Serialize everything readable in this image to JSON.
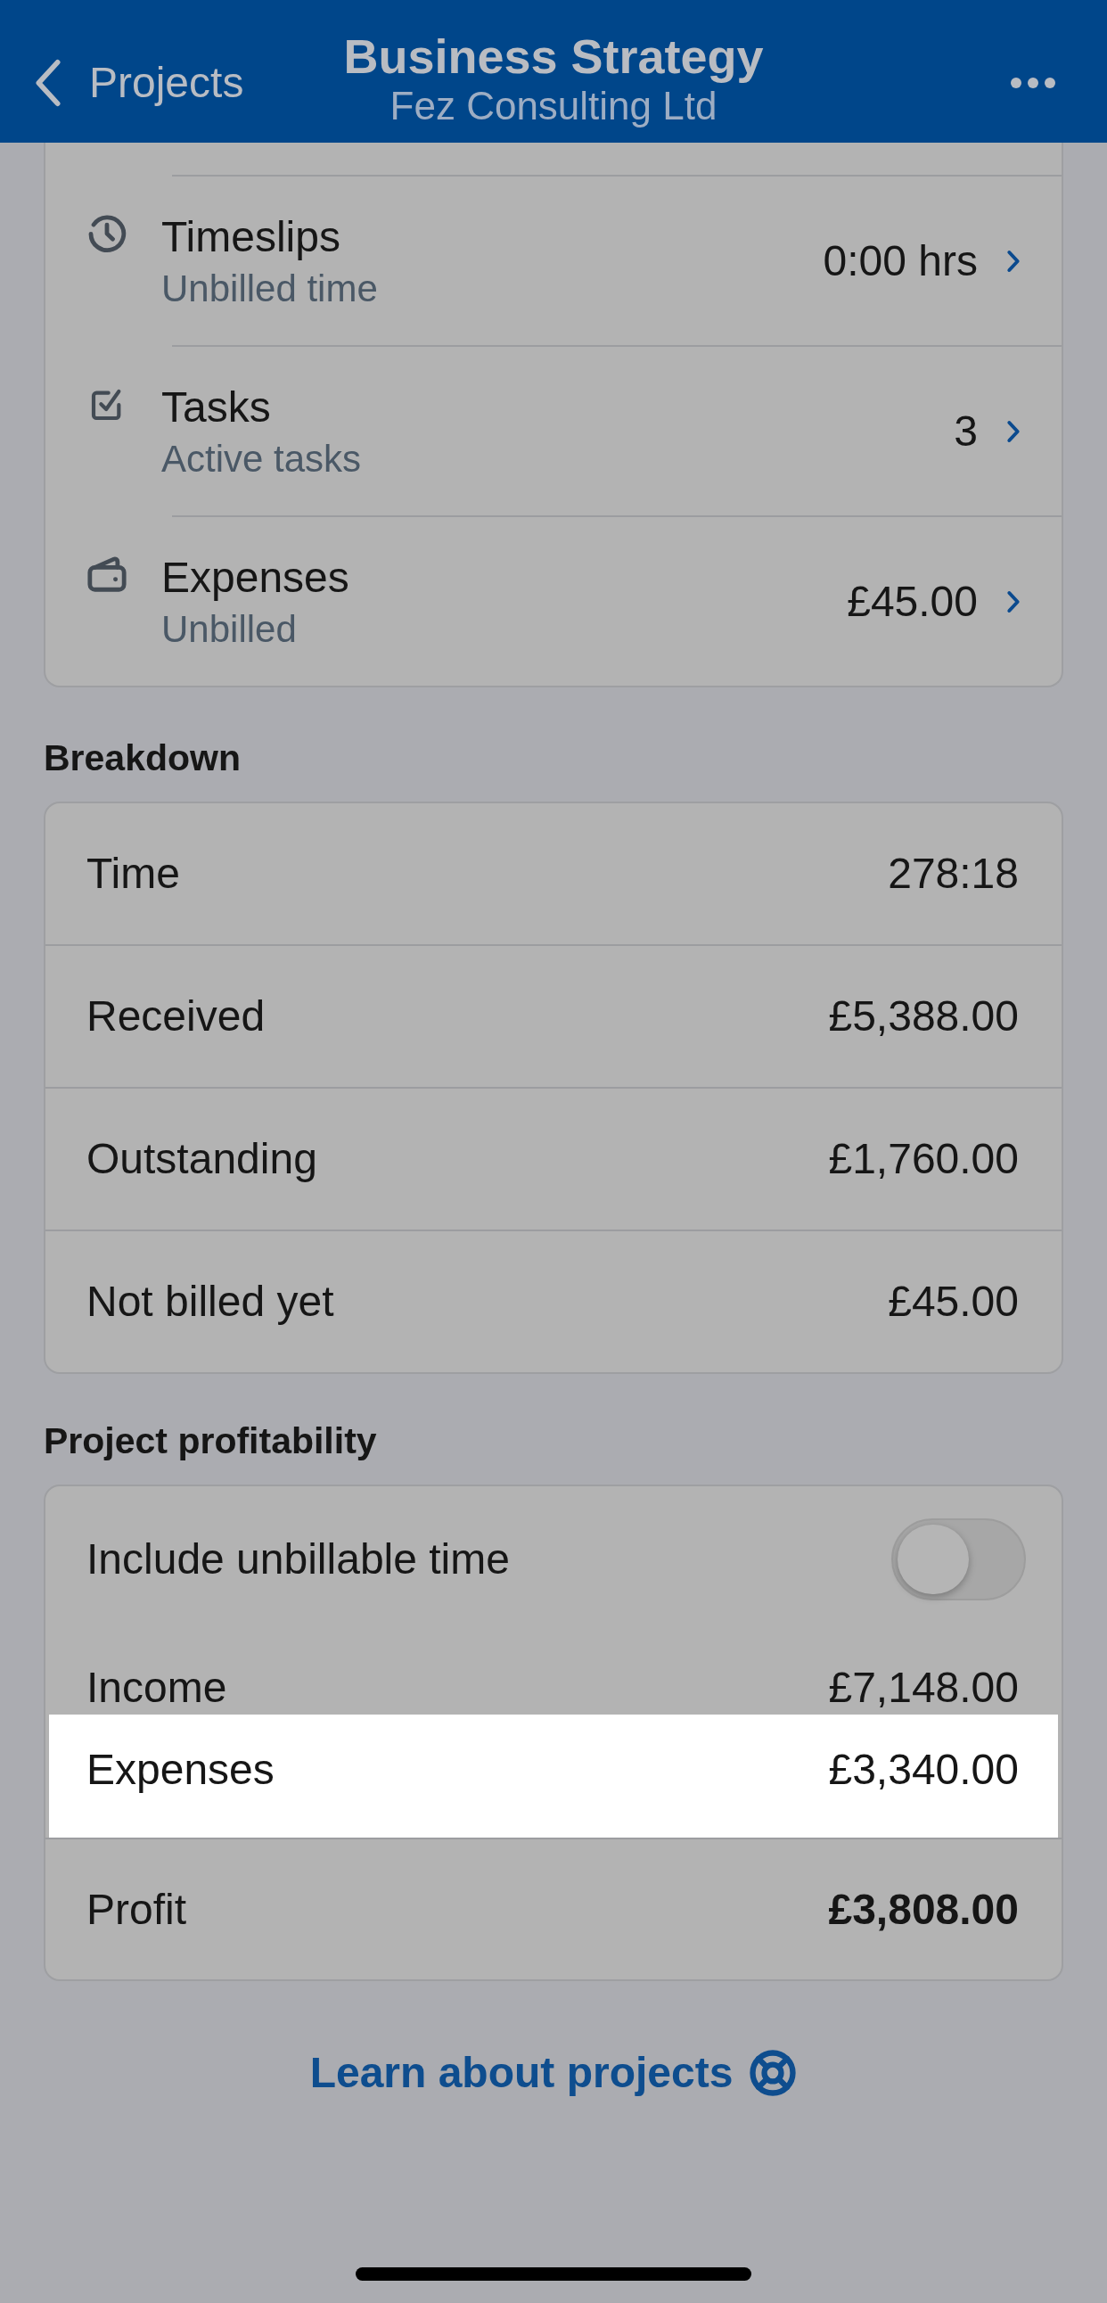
{
  "header": {
    "back_label": "Projects",
    "title": "Business Strategy",
    "subtitle": "Fez Consulting Ltd"
  },
  "summary": [
    {
      "kind": "clock",
      "title": "Timeslips",
      "subtitle": "Unbilled time",
      "value": "0:00 hrs"
    },
    {
      "kind": "tasks",
      "title": "Tasks",
      "subtitle": "Active tasks",
      "value": "3"
    },
    {
      "kind": "wallet",
      "title": "Expenses",
      "subtitle": "Unbilled",
      "value": "£45.00"
    }
  ],
  "breakdown": {
    "heading": "Breakdown",
    "rows": [
      {
        "label": "Time",
        "value": "278:18"
      },
      {
        "label": "Received",
        "value": "£5,388.00"
      },
      {
        "label": "Outstanding",
        "value": "£1,760.00"
      },
      {
        "label": "Not billed yet",
        "value": "£45.00"
      }
    ]
  },
  "profitability": {
    "heading": "Project profitability",
    "toggle": {
      "label": "Include unbillable time",
      "on": false
    },
    "rows": [
      {
        "label": "Income",
        "value": "£7,148.00",
        "highlighted": false
      },
      {
        "label": "Expenses",
        "value": "£3,340.00",
        "highlighted": true
      }
    ],
    "total": {
      "label": "Profit",
      "value": "£3,808.00"
    }
  },
  "learn_link": {
    "label": "Learn about projects"
  }
}
